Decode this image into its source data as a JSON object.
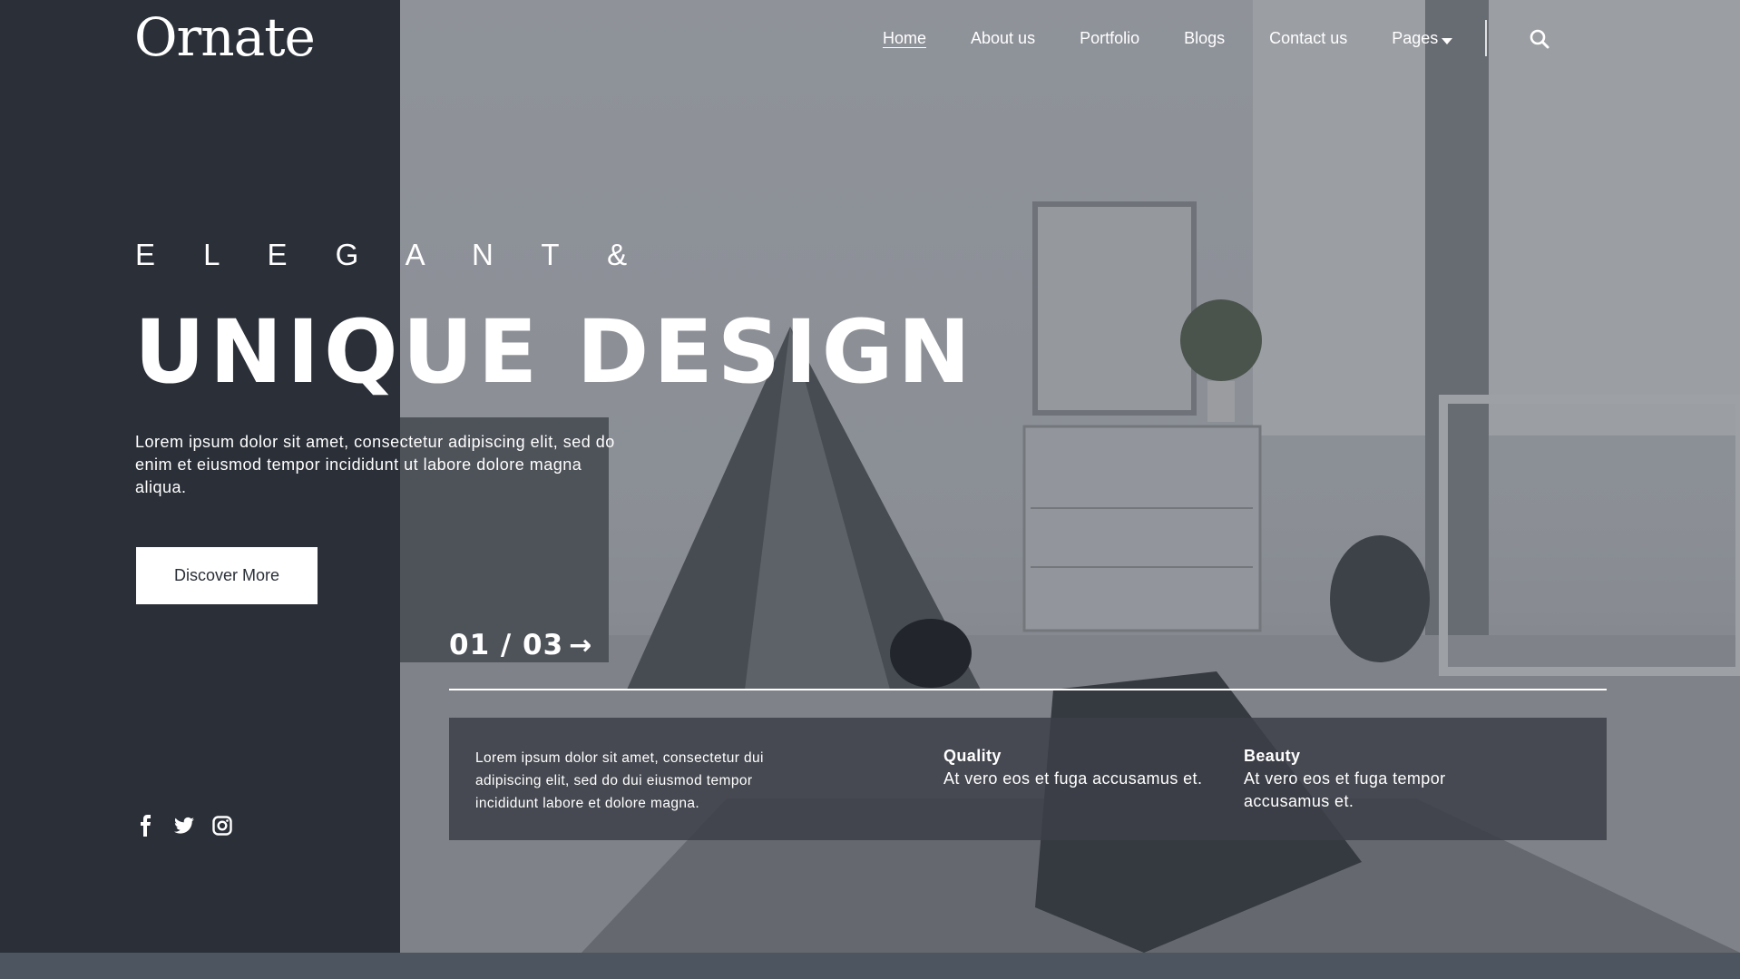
{
  "brand": {
    "logo_text": "Ornate"
  },
  "nav": {
    "items": [
      {
        "label": "Home",
        "active": true
      },
      {
        "label": "About us"
      },
      {
        "label": "Portfolio"
      },
      {
        "label": "Blogs"
      },
      {
        "label": "Contact us"
      },
      {
        "label": "Pages",
        "has_dropdown": true
      }
    ],
    "search_icon": "search-icon"
  },
  "hero": {
    "eyebrow": "E L E G A N T   &",
    "headline": "UNIQUE DESIGN",
    "intro": "Lorem ipsum dolor sit amet, consectetur adipiscing elit, sed do enim et eiusmod tempor incididunt ut labore dolore magna aliqua.",
    "cta_label": "Discover More"
  },
  "slider": {
    "counter": "01 / 03",
    "arrow": "→"
  },
  "info": {
    "text": "Lorem ipsum dolor sit amet, consectetur dui adipiscing elit, sed do dui eiusmod tempor incididunt labore et dolore magna.",
    "features": [
      {
        "title": "Quality",
        "body": "At vero eos et fuga accusamus et."
      },
      {
        "title": "Beauty",
        "body": "At vero eos et fuga tempor accusamus et."
      }
    ]
  },
  "social": [
    "facebook-icon",
    "twitter-icon",
    "instagram-icon"
  ],
  "colors": {
    "sidebar": "#2a2f38",
    "accent": "#ffffff",
    "panel": "#3c4048"
  }
}
